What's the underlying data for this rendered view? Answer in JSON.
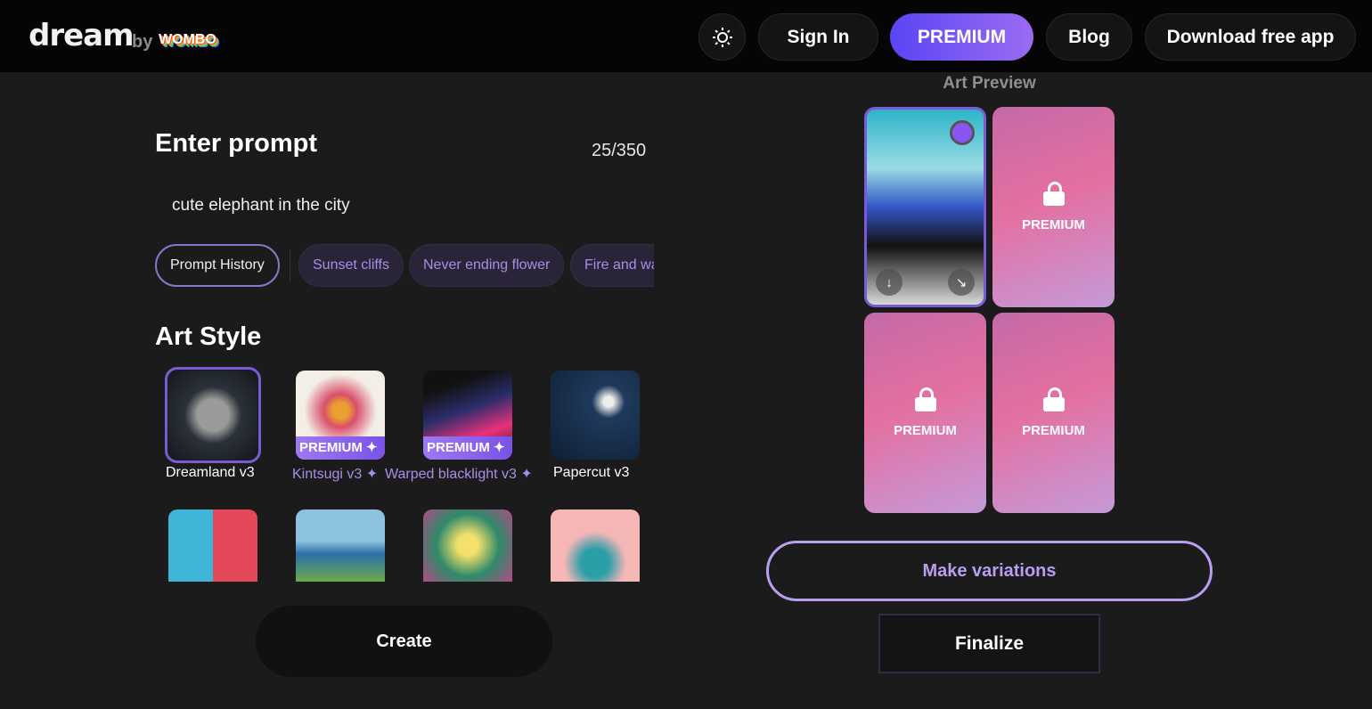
{
  "header": {
    "logo": "dream",
    "by": "by",
    "brand": "WOMBO",
    "sign_in": "Sign In",
    "premium": "PREMIUM",
    "blog": "Blog",
    "download": "Download free app",
    "theme_icon": "sun-icon"
  },
  "prompt": {
    "title": "Enter prompt",
    "counter": "25/350",
    "value": "cute elephant in the city",
    "history": "Prompt History",
    "suggestions": [
      "Sunset cliffs",
      "Never ending flower",
      "Fire and water"
    ]
  },
  "art_style": {
    "title": "Art Style",
    "badge": "PREMIUM ✦",
    "styles": [
      {
        "name": "Dreamland v3",
        "premium": false,
        "selected": true
      },
      {
        "name": "Kintsugi v3 ✦",
        "premium": true
      },
      {
        "name": "Warped blacklight v3 ✦",
        "premium": true
      },
      {
        "name": "Papercut v3",
        "premium": false
      }
    ]
  },
  "create": "Create",
  "preview": {
    "title": "Art Preview",
    "locked_label": "PREMIUM",
    "download_icon": "↓",
    "expand_icon": "↘"
  },
  "actions": {
    "make_variations": "Make variations",
    "finalize": "Finalize"
  },
  "colors": {
    "accent": "#7a5bd6",
    "premium_start": "#5a45f5",
    "premium_end": "#9b6cf2",
    "background": "#1b1b1b"
  }
}
